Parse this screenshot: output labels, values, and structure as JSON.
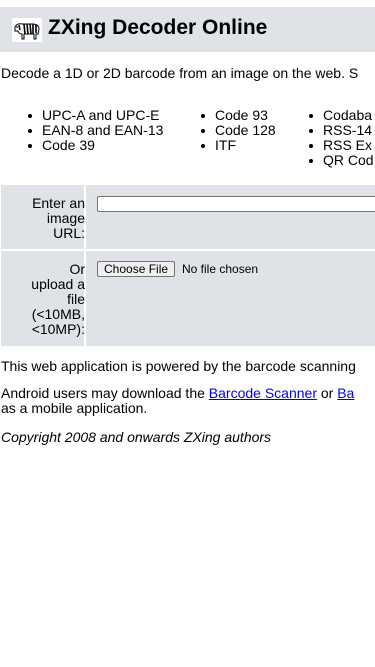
{
  "header": {
    "title": "ZXing Decoder Online",
    "logo_icon": "zebra-logo-icon",
    "background": "#dfe2e6"
  },
  "intro": {
    "text": "Decode a 1D or 2D barcode from an image on the web. S"
  },
  "formats": {
    "col1": [
      "UPC-A and UPC-E",
      "EAN-8 and EAN-13",
      "Code 39"
    ],
    "col2": [
      "Code 93",
      "Code 128",
      "ITF"
    ],
    "col3": [
      "Codaba",
      "RSS-14",
      "RSS Ex",
      "QR Cod"
    ]
  },
  "form": {
    "url_label": [
      "Enter an",
      "image",
      "URL:"
    ],
    "url_value": "",
    "upload_label": [
      "Or",
      "upload a",
      "file",
      "(<10MB,",
      "<10MP):"
    ],
    "choose_file_button": "Choose File",
    "file_status": "No file chosen"
  },
  "footer": {
    "powered_text": "This web application is powered by the barcode scanning",
    "android_prefix": "Android users may download the ",
    "android_link1": "Barcode Scanner",
    "android_mid": " or ",
    "android_link2": "Ba",
    "android_line2": "as a mobile application.",
    "copyright": "Copyright 2008 and onwards ZXing authors",
    "link_color": "#0000ee"
  }
}
